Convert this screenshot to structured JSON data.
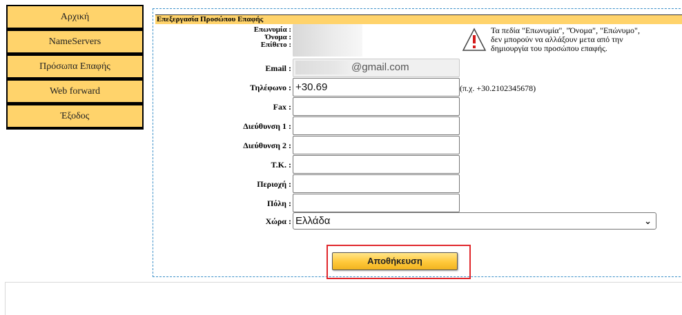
{
  "nav": {
    "items": [
      {
        "label": "Αρχική"
      },
      {
        "label": "NameServers"
      },
      {
        "label": "Πρόσωπα Επαφής"
      },
      {
        "label": "Web forward"
      },
      {
        "label": "Έξοδος"
      }
    ]
  },
  "form": {
    "title": "Επεξεργασία Προσώπου Επαφής",
    "labels": {
      "company": "Επωνυμία :",
      "first_name": "Όνομα :",
      "last_name": "Επίθετο :",
      "email": "Email :",
      "phone": "Τηλέφωνο :",
      "fax": "Fax :",
      "address1": "Διεύθυνση 1 :",
      "address2": "Διεύθυνση 2 :",
      "postcode": "Τ.Κ. :",
      "region": "Περιοχή :",
      "city": "Πόλη :",
      "country": "Χώρα :"
    },
    "values": {
      "email_suffix": "@gmail.com",
      "phone": "+30.69",
      "fax": "",
      "address1": "",
      "address2": "",
      "postcode": "",
      "region": "",
      "city": "",
      "country": "Ελλάδα"
    },
    "phone_hint": "(π.χ. +30.2102345678)",
    "warning": {
      "line1": "Τα πεδία \"Επωνυμία\", \"Όνομα\", \"Επώνυμο\",",
      "line2": "δεν μπορούν να αλλάξουν μετα από την",
      "line3": "δημιουργία του προσώπου επαφής."
    },
    "save_label": "Αποθήκευση"
  },
  "colors": {
    "accent": "#ffd36b",
    "panel_border": "#3a8fc8",
    "highlight": "#e0262b"
  },
  "icons": {
    "warning": "warning-icon",
    "dropdown": "chevron-down-icon"
  }
}
